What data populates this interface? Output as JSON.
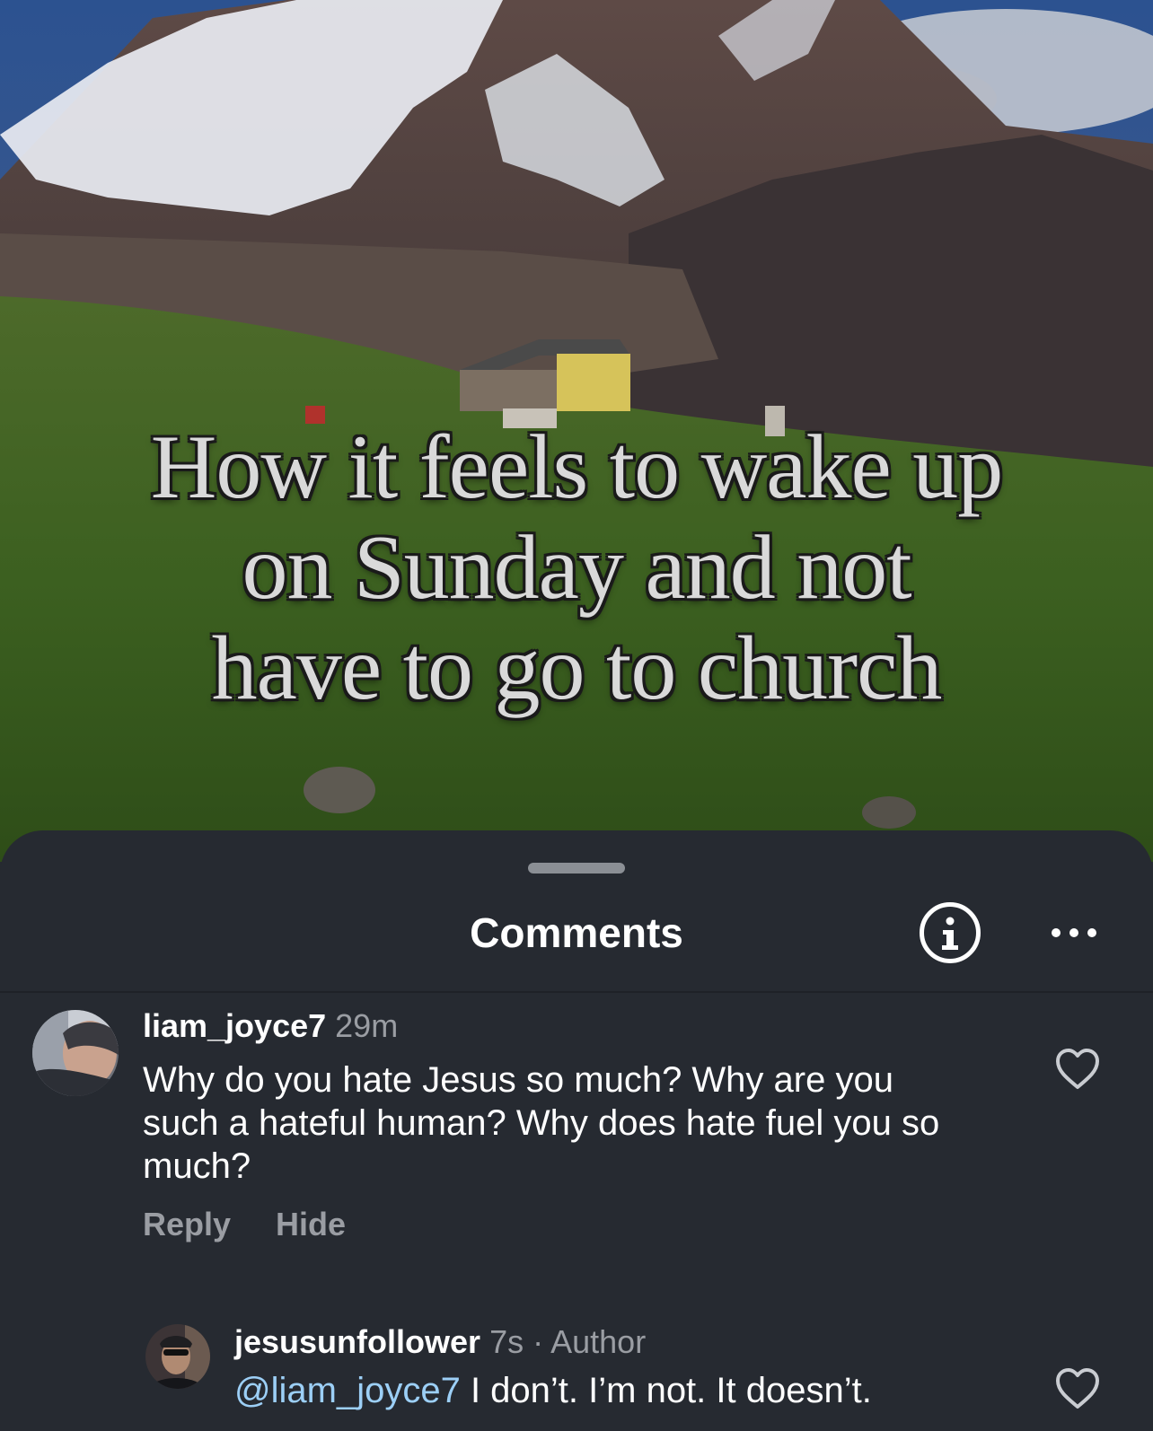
{
  "video": {
    "overlay_lines": [
      "How it feels to wake up",
      "on Sunday and not",
      "have to go to church"
    ]
  },
  "comments_sheet": {
    "title": "Comments",
    "info_icon": "info-circle-icon",
    "more_icon": "ellipsis-icon"
  },
  "comments": [
    {
      "username": "liam_joyce7",
      "time": "29m",
      "text": "Why do you hate Jesus so much? Why are you such a hateful human? Why does hate fuel you so much?",
      "actions": {
        "reply": "Reply",
        "hide": "Hide"
      }
    },
    {
      "username": "jesusunfollower",
      "time": "7s",
      "separator": "·",
      "badge": "Author",
      "mention": "@liam_joyce7",
      "text": " I don’t. I’m not. It doesn’t."
    }
  ],
  "colors": {
    "sheet_bg": "#262a31",
    "mention": "#9ccff6",
    "muted": "#9a9da3"
  }
}
